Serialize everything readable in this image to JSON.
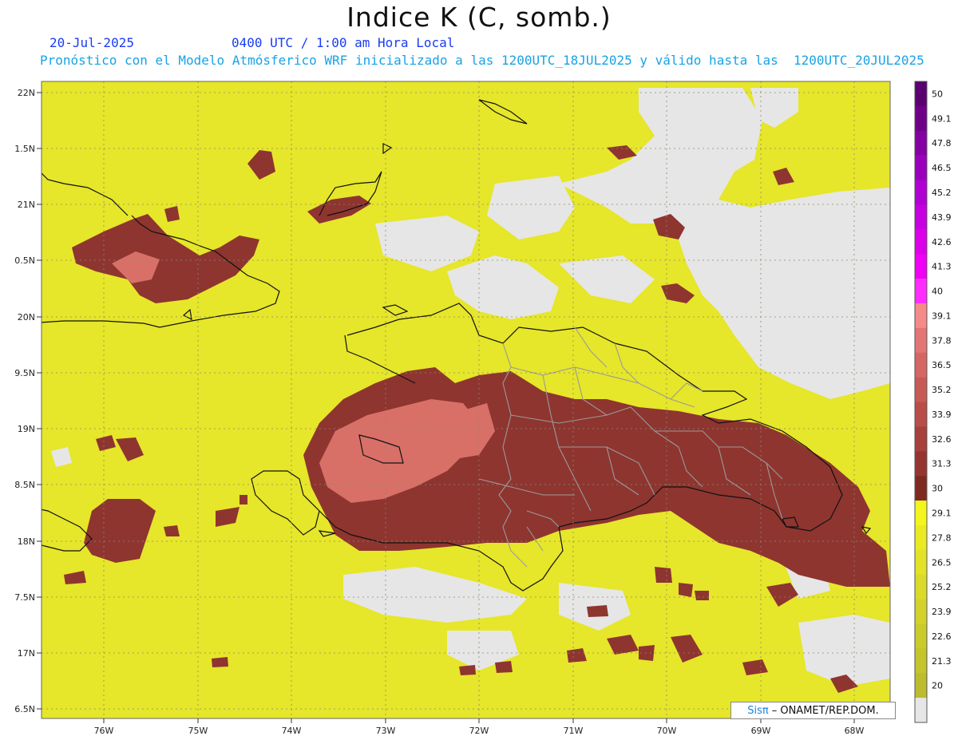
{
  "title": "Indice K (C, somb.)",
  "date_label": "20-Jul-2025",
  "valid_label": "0400 UTC / 1:00 am Hora Local",
  "description": "Pronóstico con el Modelo Atmósferico WRF inicializado a las 1200UTC_18JUL2025 y válido hasta las  1200UTC_20JUL2025",
  "credit": {
    "logo": "Sisπ",
    "text": "– ONAMET/REP.DOM."
  },
  "map": {
    "lat_labels": [
      "22N",
      "1.5N",
      "21N",
      "0.5N",
      "20N",
      "9.5N",
      "19N",
      "8.5N",
      "18N",
      "7.5N",
      "17N",
      "6.5N"
    ],
    "lon_labels": [
      "76W",
      "75W",
      "74W",
      "73W",
      "72W",
      "71W",
      "70W",
      "69W",
      "68W"
    ]
  },
  "legend": {
    "items": [
      {
        "label": "50",
        "color": "#5a0070"
      },
      {
        "label": "49.1",
        "color": "#6e0088"
      },
      {
        "label": "47.8",
        "color": "#8400a2"
      },
      {
        "label": "46.5",
        "color": "#9a00bc"
      },
      {
        "label": "45.2",
        "color": "#b000d2"
      },
      {
        "label": "43.9",
        "color": "#c600e0"
      },
      {
        "label": "42.6",
        "color": "#dc00ea"
      },
      {
        "label": "41.3",
        "color": "#f000f5"
      },
      {
        "label": "40",
        "color": "#ff2cff"
      },
      {
        "label": "39.1",
        "color": "#f48a8a"
      },
      {
        "label": "37.8",
        "color": "#e47575"
      },
      {
        "label": "36.5",
        "color": "#d66663"
      },
      {
        "label": "35.2",
        "color": "#c85a55"
      },
      {
        "label": "33.9",
        "color": "#b94d47"
      },
      {
        "label": "32.6",
        "color": "#a8413b"
      },
      {
        "label": "31.3",
        "color": "#963530"
      },
      {
        "label": "30",
        "color": "#7e2a20"
      },
      {
        "label": "29.1",
        "color": "#f5f51e"
      },
      {
        "label": "27.8",
        "color": "#eaea22"
      },
      {
        "label": "26.5",
        "color": "#e2e226"
      },
      {
        "label": "25.2",
        "color": "#dada28"
      },
      {
        "label": "23.9",
        "color": "#d2d22a"
      },
      {
        "label": "22.6",
        "color": "#cbcb2b"
      },
      {
        "label": "21.3",
        "color": "#c4c42c"
      },
      {
        "label": "20",
        "color": "#bcbc2e"
      },
      {
        "label": "",
        "color": "#e6e6e6"
      }
    ]
  },
  "colors": {
    "land_line": "#111111",
    "province_line": "#9a9a9a",
    "no_data": "#e6e6e6",
    "field_base": "#e6e62a"
  }
}
